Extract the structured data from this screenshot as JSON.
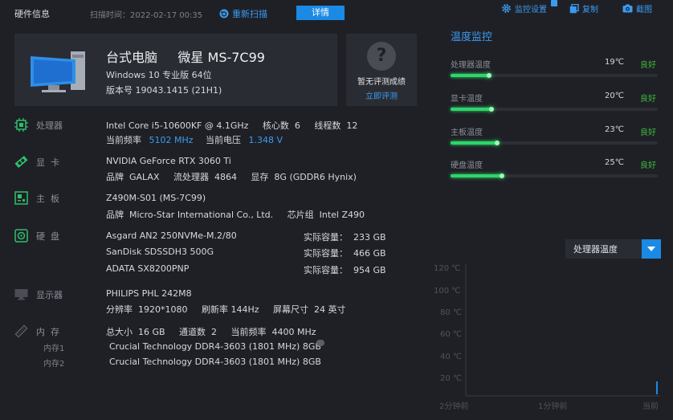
{
  "topbar": {
    "title": "硬件信息",
    "scan_time": "扫描时间：2022-02-17 00:35",
    "rescan": "重新扫描",
    "detail": "详情",
    "monitor_settings": "监控设置",
    "copy": "复制",
    "screenshot": "截图"
  },
  "summary": {
    "model": "台式电脑     微星 MS-7C99",
    "os": "Windows 10 专业版 64位",
    "version": "版本号  19043.1415 (21H1)",
    "eval_text": "暂无评测成绩",
    "eval_link": "立即评测",
    "eval_icon": "?"
  },
  "cpu": {
    "label": "处理器",
    "line1": "Intel Core i5-10600KF @ 4.1GHz     核心数  6     线程数  12",
    "freq_label": "当前频率",
    "freq": "5102 MHz",
    "volt_label": "当前电压",
    "volt": "1.348 V"
  },
  "gpu": {
    "label": "显  卡",
    "line1": "NVIDIA GeForce RTX 3060 Ti",
    "line2": "品牌  GALAX     流处理器  4864     显存  8G (GDDR6 Hynix)"
  },
  "board": {
    "label": "主  板",
    "line1": "Z490M-S01 (MS-7C99)",
    "line2": "品牌  Micro-Star International Co., Ltd.     芯片组  Intel Z490"
  },
  "disk": {
    "label": "硬  盘",
    "items": [
      {
        "name": "Asgard AN2 250NVMe-M.2/80",
        "capacity": "实际容量：  233 GB"
      },
      {
        "name": "SanDisk SDSSDH3 500G",
        "capacity": "实际容量：  466 GB"
      },
      {
        "name": "ADATA SX8200PNP",
        "capacity": "实际容量：  954 GB"
      }
    ]
  },
  "display": {
    "label": "显示器",
    "line1": "PHILIPS PHL 242M8",
    "line2": "分辨率  1920*1080     刷新率 144Hz     屏幕尺寸  24 英寸"
  },
  "memory": {
    "label": "内  存",
    "line1": "总大小  16 GB     通道数  2     当前频率  4400 MHz",
    "slots": [
      {
        "label": "内存1",
        "value": "Crucial Technology DDR4-3603 (1801 MHz) 8GB"
      },
      {
        "label": "内存2",
        "value": "Crucial Technology DDR4-3603 (1801 MHz) 8GB"
      }
    ]
  },
  "monitor": {
    "title": "温度监控",
    "rows": [
      {
        "name": "处理器温度",
        "value": "19℃",
        "state": "良好",
        "level": 0.19
      },
      {
        "name": "显卡温度",
        "value": "20℃",
        "state": "良好",
        "level": 0.2
      },
      {
        "name": "主板温度",
        "value": "23℃",
        "state": "良好",
        "level": 0.23
      },
      {
        "name": "硬盘温度",
        "value": "25℃",
        "state": "良好",
        "level": 0.25
      }
    ],
    "selected": "处理器温度",
    "y_ticks": [
      "120 ℃",
      "100 ℃",
      "80 ℃",
      "60 ℃",
      "40 ℃",
      "20 ℃"
    ],
    "x_ticks": [
      "2分钟前",
      "1分钟前",
      "当前"
    ]
  },
  "colors": {
    "accent": "#1a8ae5",
    "good": "#3dbb3d",
    "bar": "#2fd46a"
  }
}
